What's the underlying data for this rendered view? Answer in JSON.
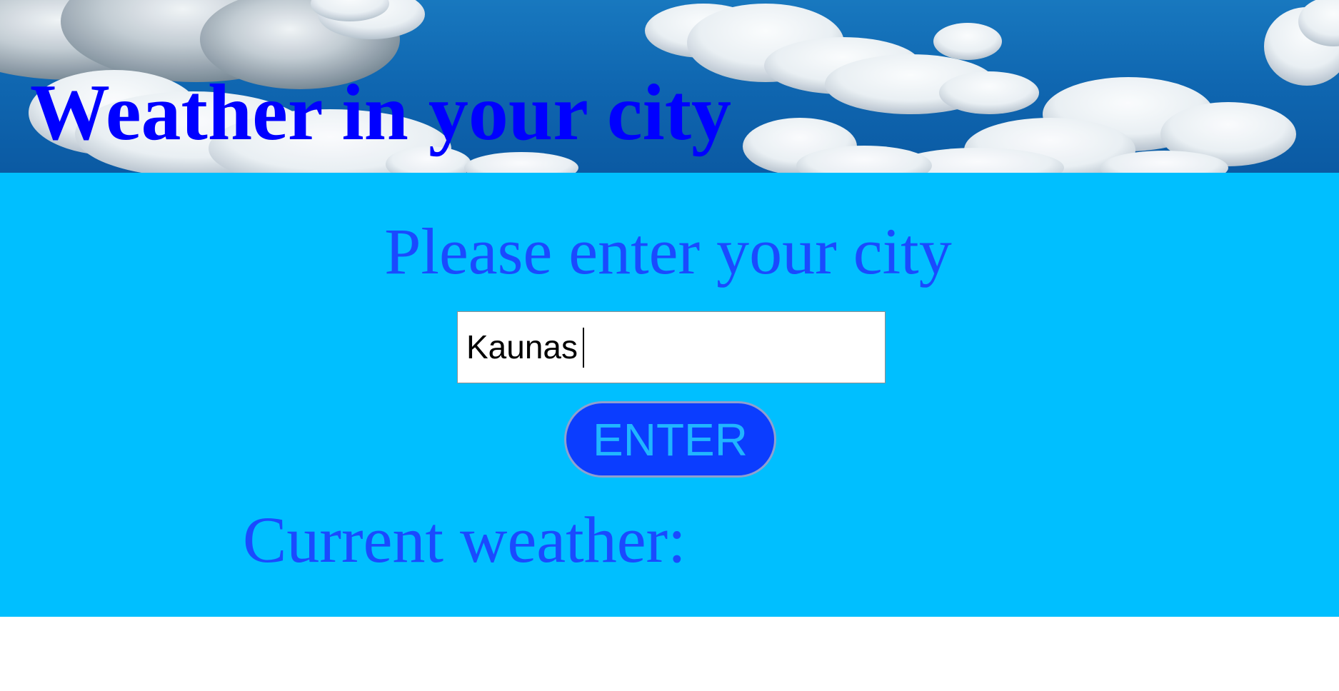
{
  "header": {
    "title": "Weather in your city"
  },
  "main": {
    "prompt": "Please enter your city",
    "city_input": {
      "value": "Kaunas",
      "placeholder": ""
    },
    "enter_button": {
      "label": "ENTER"
    },
    "current_weather_label": "Current weather:"
  },
  "colors": {
    "title": "#0000ff",
    "content_background": "#00bfff",
    "prompt_text": "#1a4aff",
    "button_background": "#0b3dff",
    "button_text": "#20b6ff"
  },
  "icons": [
    "sky-cloud-background"
  ]
}
